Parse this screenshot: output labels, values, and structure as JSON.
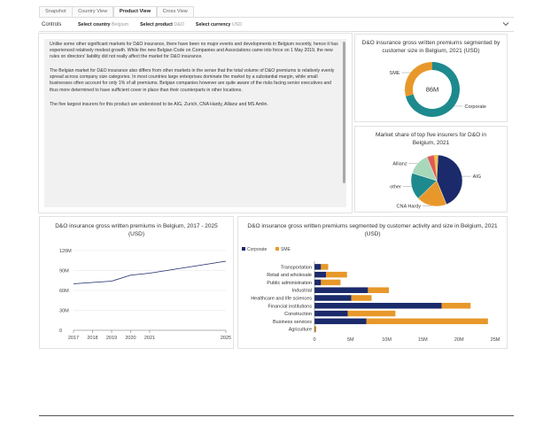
{
  "tabs": [
    {
      "label": "Snapshot",
      "active": false
    },
    {
      "label": "Country View",
      "active": false
    },
    {
      "label": "Product View",
      "active": true
    },
    {
      "label": "Cross View",
      "active": false
    }
  ],
  "controls": {
    "title": "Controls",
    "country_label": "Select country",
    "country_value": "Belgium",
    "product_label": "Select product",
    "product_value": "D&O",
    "currency_label": "Select currency",
    "currency_value": "USD",
    "chevron_icon": "chevron-down-icon"
  },
  "commentary": {
    "paragraphs": [
      "Unlike some other significant markets for D&O insurance, there have been no major events and developments in Belgium recently, hence it has experienced relatively modest growth. While the new Belgian Code on Companies and Associations came into force on 1 May 2019, the new rules on directors' liability did not really affect the market for D&O insurance.",
      "The Belgian market for D&O insurance also differs from other markets in the sense that the total volume of D&O premiums is relatively evenly spread across company size categories. In most countries large enterprises dominate the market by a substantial margin, while small businesses often account for only 1% of all premiums. Belgian companies however are quite aware of the risks facing senior executives and thus more determined to have sufficient cover in place than their counterparts in other locations.",
      "The five largest insurers for this product are understood to be AIG, Zurich, CNA Hardy, Allianz and MS Amlin."
    ]
  },
  "colors": {
    "corporate": "#1a2a6b",
    "sme": "#e8982a",
    "teal": "#1e8a8e",
    "green": "#a8d8b9",
    "red": "#e05a5a",
    "pie_yellow": "#f2c14e"
  },
  "chart_data": [
    {
      "id": "donut",
      "type": "pie",
      "title": "D&O insurance gross written premiums segmented by customer size in Belgium, 2021 (USD)",
      "center_label": "86M",
      "categories": [
        "Corporate",
        "SME"
      ],
      "values": [
        61,
        25
      ],
      "series_colors": [
        "#1e8a8e",
        "#e8982a"
      ]
    },
    {
      "id": "share-pie",
      "type": "pie",
      "title": "Market share of top five insurers for D&O in Belgium, 2021",
      "categories": [
        "AIG",
        "CNA Hardy",
        "other",
        "Allianz",
        "red-slice"
      ],
      "labels_shown": [
        "AIG",
        "CNA Hardy",
        "other",
        "Allianz"
      ],
      "values": [
        43,
        19,
        17,
        14,
        7
      ],
      "series_colors": [
        "#1a2a6b",
        "#e8982a",
        "#1e8a8e",
        "#a8d8b9",
        "#e05a5a"
      ]
    },
    {
      "id": "line",
      "type": "line",
      "title": "D&O insurance gross written premiums in Belgium, 2017 - 2025 (USD)",
      "x": [
        "2017",
        "2018",
        "2019",
        "2020",
        "2021",
        "2025"
      ],
      "x_positions": [
        2017,
        2018,
        2019,
        2020,
        2021,
        2025
      ],
      "x_ticks": [
        "2017",
        "2018",
        "2019",
        "2020",
        "2021",
        "2025"
      ],
      "values": [
        70,
        72,
        74,
        83,
        86,
        104
      ],
      "y_ticks": [
        "0",
        "30M",
        "60M",
        "90M",
        "120M"
      ],
      "ylim": [
        0,
        120
      ],
      "grid": true,
      "color": "#1a2a6b"
    },
    {
      "id": "stacked-bar",
      "type": "bar",
      "orientation": "horizontal",
      "stacked": true,
      "title": "D&O insurance gross written premiums segmented by customer activity and size in Belgium, 2021 (USD)",
      "categories": [
        "Transportation",
        "Retail and wholesale",
        "Public administration",
        "Industrial",
        "Healthcare and life sciences",
        "Financial institutions",
        "Construction",
        "Business services",
        "Agriculture"
      ],
      "series": [
        {
          "name": "Corporate",
          "values": [
            0.9,
            1.6,
            0.9,
            7.4,
            5.1,
            17.6,
            4.6,
            7.2,
            0.05
          ],
          "color": "#1a2a6b"
        },
        {
          "name": "SME",
          "values": [
            1.0,
            2.9,
            2.7,
            2.9,
            2.8,
            4.0,
            6.6,
            16.8,
            0.2
          ],
          "color": "#e8982a"
        }
      ],
      "x_ticks": [
        "0",
        "5M",
        "10M",
        "15M",
        "20M",
        "25M"
      ],
      "xlim": [
        0,
        25
      ],
      "legend": "top-left"
    }
  ]
}
